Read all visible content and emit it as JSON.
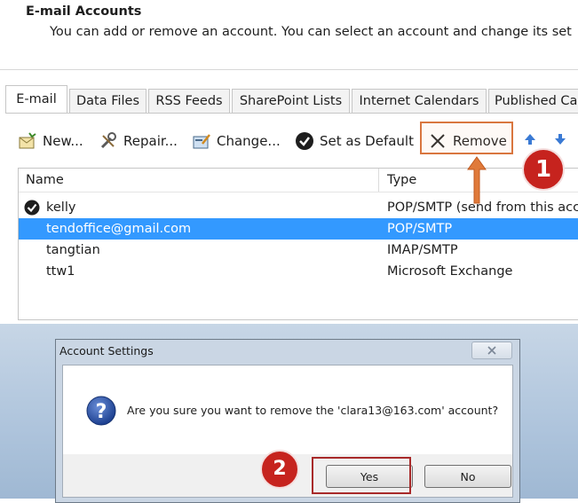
{
  "header": {
    "title": "E-mail Accounts",
    "description": "You can add or remove an account. You can select an account and change its set"
  },
  "tabs": [
    "E-mail",
    "Data Files",
    "RSS Feeds",
    "SharePoint Lists",
    "Internet Calendars",
    "Published Ca"
  ],
  "toolbar": {
    "new_label": "New...",
    "repair_label": "Repair...",
    "change_label": "Change...",
    "set_default_label": "Set as Default",
    "remove_label": "Remove"
  },
  "list": {
    "col_name": "Name",
    "col_type": "Type",
    "rows": [
      {
        "name": "kelly",
        "type": "POP/SMTP (send from this acc"
      },
      {
        "name": "tendoffice@gmail.com",
        "type": "POP/SMTP"
      },
      {
        "name": "tangtian",
        "type": "IMAP/SMTP"
      },
      {
        "name": "ttw1",
        "type": "Microsoft Exchange"
      }
    ]
  },
  "steps": {
    "one": "1",
    "two": "2"
  },
  "dialog": {
    "title": "Account Settings",
    "message": "Are you sure you want to remove the 'clara13@163.com' account?",
    "yes_label": "Yes",
    "no_label": "No"
  },
  "colors": {
    "selection": "#3399ff",
    "step_badge": "#c6231e",
    "remove_highlight": "#d9763f",
    "yes_highlight": "#a82a2a",
    "desktop": "#aec4dc"
  },
  "icons": [
    "new-account-icon",
    "repair-icon",
    "change-icon",
    "check-icon",
    "remove-x-icon",
    "move-up-icon",
    "move-down-icon",
    "question-icon",
    "close-icon"
  ]
}
